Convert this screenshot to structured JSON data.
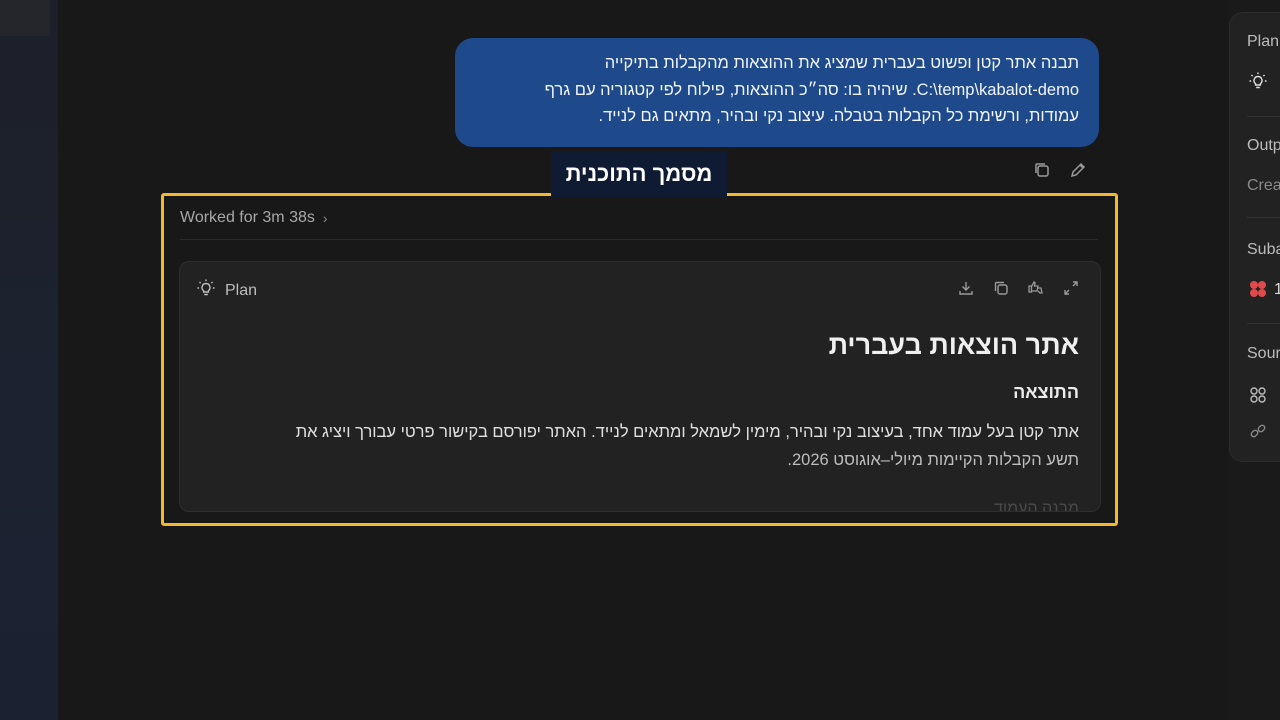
{
  "user_message": {
    "line1": "תבנה אתר קטן ופשוט בעברית שמציג את ההוצאות מהקבלות בתיקייה",
    "line2_path": "C:\\temp\\kabalot-demo",
    "line2_rest": ". שיהיה בו: סה״כ ההוצאות, פילוח לפי קטגוריה עם גרף",
    "line3": "עמודות, ורשימת כל הקבלות בטבלה. עיצוב נקי ובהיר, מתאים גם לנייד."
  },
  "overlay_caption": "מסמך התוכנית",
  "worked": {
    "label": "Worked for 3m 38s",
    "chevron": "›"
  },
  "plan": {
    "header_label": "Plan",
    "title": "אתר הוצאות בעברית",
    "section_heading": "התוצאה",
    "para_line1": "אתר קטן בעל עמוד אחד, בעיצוב נקי ובהיר, מימין לשמאל ומתאים לנייד. האתר יפורסם בקישור פרטי עבורך ויציג את",
    "para_line2": "תשע הקבלות הקיימות מיולי–אוגוסט 2026.",
    "faded_next": "מבנה העמוד"
  },
  "right_panel": {
    "plan_label": "Plan",
    "output_label": "Outp",
    "create_label": "Crea",
    "subagents_label": "Suba",
    "subagents_count": "1",
    "sources_label": "Sour"
  },
  "icons": {
    "lightbulb": "lightbulb-icon",
    "copy": "copy-icon",
    "edit": "pencil-icon",
    "download": "download-icon",
    "feedback": "thumbs-icon",
    "expand": "expand-icon"
  },
  "colors": {
    "bubble": "#1e4a8c",
    "highlight": "#f3b730",
    "caption_bg": "#0f1b33"
  }
}
